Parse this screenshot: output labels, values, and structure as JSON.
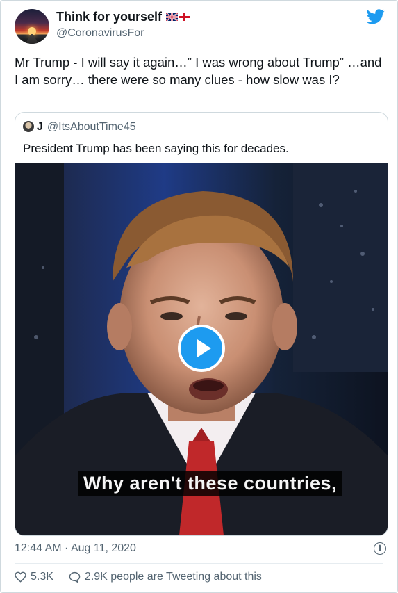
{
  "author": {
    "name": "Think for yourself",
    "flags": [
      "union-jack-icon",
      "england-flag-icon"
    ],
    "handle": "@CoronavirusFor"
  },
  "tweet": {
    "text": "Mr Trump - I will say it again…”  I was wrong about Trump”  …and I am sorry… there were so many clues - how slow was I?"
  },
  "quoted": {
    "name": "J",
    "handle": "@ItsAboutTime45",
    "text": "President Trump has been saying this for decades.",
    "video": {
      "subtitle": "Why aren't these countries,"
    }
  },
  "meta": {
    "timestamp": "12:44 AM · Aug 11, 2020",
    "likes": "5.3K",
    "tweeting": "2.9K people are Tweeting about this"
  },
  "colors": {
    "accent": "#1d9bf0",
    "text": "#0f1419",
    "muted": "#536471"
  },
  "icons": {
    "brand": "twitter-bird-icon",
    "info": "info-icon",
    "like": "heart-icon",
    "reply": "speech-bubble-icon",
    "play": "play-icon"
  }
}
